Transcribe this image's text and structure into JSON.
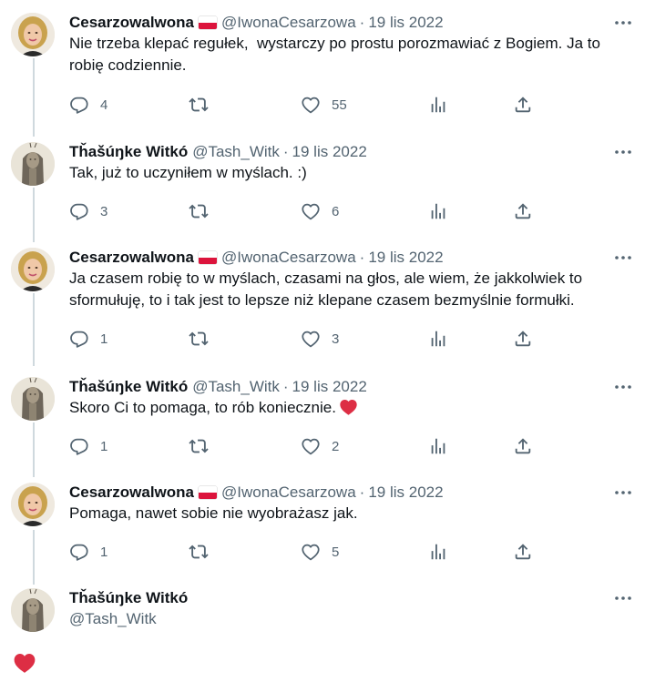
{
  "colors": {
    "text": "#0f1419",
    "secondary": "#536471",
    "thread_line": "#cfd9de",
    "heart": "#e0245e",
    "flag_red": "#dc143c"
  },
  "tweets": [
    {
      "name": "Cesarzowalwona",
      "flag": "poland-flag",
      "handle": "@IwonaCesarzowa",
      "time": "19 lis 2022",
      "text": "Nie trzeba klepać regułek,  wystarczy po prostu porozmawiać z Bogiem. Ja to robię codziennie.",
      "replies": "4",
      "retweets": "",
      "likes": "55"
    },
    {
      "name": "Tȟašúŋke Witkó",
      "handle": "@Tash_Witk",
      "time": "19 lis 2022",
      "text": "Tak, już to uczyniłem w myślach. :)",
      "replies": "3",
      "retweets": "",
      "likes": "6"
    },
    {
      "name": "Cesarzowalwona",
      "flag": "poland-flag",
      "handle": "@IwonaCesarzowa",
      "time": "19 lis 2022",
      "text": "Ja czasem robię to w myślach, czasami na głos, ale wiem, że jakkolwiek to sformułuję, to i tak jest to lepsze niż klepane czasem bezmyślnie formułki.",
      "replies": "1",
      "retweets": "",
      "likes": "3"
    },
    {
      "name": "Tȟašúŋke Witkó",
      "handle": "@Tash_Witk",
      "time": "19 lis 2022",
      "text": "Skoro Ci to pomaga, to rób koniecznie.",
      "text_emoji": "red-heart-icon",
      "replies": "1",
      "retweets": "",
      "likes": "2"
    },
    {
      "name": "Cesarzowalwona",
      "flag": "poland-flag",
      "handle": "@IwonaCesarzowa",
      "time": "19 lis 2022",
      "text": "Pomaga, nawet sobie nie wyobrażasz jak.",
      "replies": "1",
      "retweets": "",
      "likes": "5"
    }
  ],
  "last_tweet": {
    "name": "Tȟašúŋke Witkó",
    "handle": "@Tash_Witk",
    "emoji": "red-heart-icon"
  },
  "icons": {
    "more": "more-horizontal-icon",
    "reply": "reply-icon",
    "retweet": "retweet-icon",
    "like": "heart-outline-icon",
    "views": "views-chart-icon",
    "share": "share-icon"
  }
}
